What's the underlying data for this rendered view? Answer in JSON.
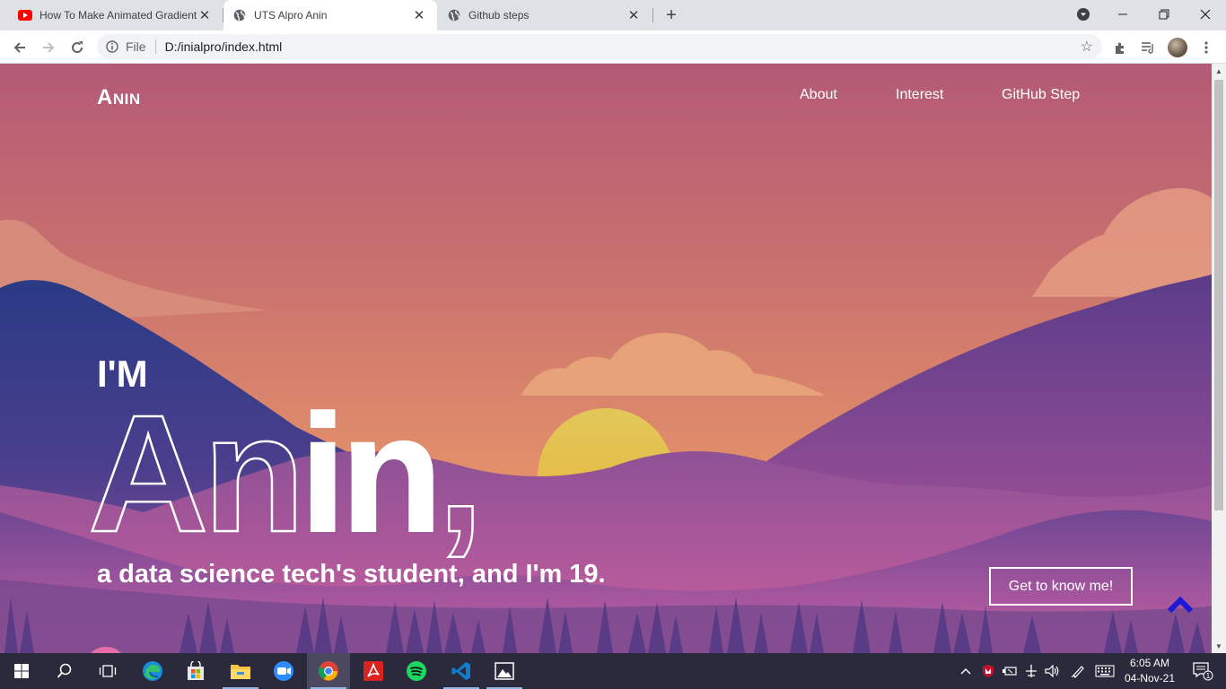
{
  "browser": {
    "tabs": [
      {
        "title": "How To Make Animated Gradient",
        "favicon": "youtube-icon"
      },
      {
        "title": "UTS Alpro Anin",
        "favicon": "globe-icon",
        "active": true
      },
      {
        "title": "Github steps",
        "favicon": "globe-icon"
      }
    ],
    "address": {
      "scheme": "File",
      "url": "D:/inialpro/index.html"
    }
  },
  "page": {
    "brand": "Anin",
    "nav": [
      {
        "label": "About"
      },
      {
        "label": "Interest"
      },
      {
        "label": "GitHub Step"
      }
    ],
    "hero": {
      "intro": "I'M",
      "name": "Anin,",
      "subtitle": "a data science tech's student, and I'm 19."
    },
    "cta_label": "Get to know me!",
    "colors": {
      "sky_top": "#b35a7a",
      "sky_bottom": "#e3906a",
      "sun": "#e8c24a",
      "back_to_top": "#1a1ad6"
    }
  },
  "taskbar": {
    "apps": [
      "windows-start-icon",
      "search-icon",
      "task-view-icon",
      "edge-icon",
      "store-icon",
      "file-explorer-icon",
      "zoom-icon",
      "chrome-icon",
      "acrobat-icon",
      "spotify-icon",
      "vscode-icon",
      "photos-icon"
    ],
    "clock": {
      "time": "6:05 AM",
      "date": "04-Nov-21"
    },
    "notifications": "1"
  }
}
